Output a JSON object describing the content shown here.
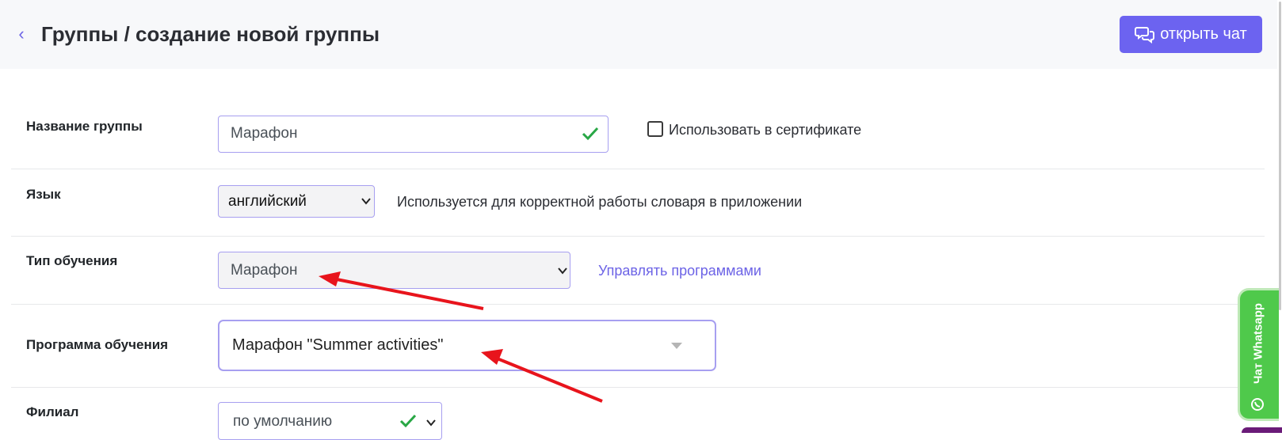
{
  "header": {
    "back_icon": "chevron-left-icon",
    "title": "Группы / создание новой группы",
    "chat_button": {
      "icon": "chat-bubbles-icon",
      "label": "открыть чат"
    }
  },
  "form": {
    "group_name": {
      "label": "Название группы",
      "value": "Марафон",
      "valid_icon": "checkmark-icon",
      "use_in_certificate": {
        "label": "Использовать в сертификате",
        "checked": false
      }
    },
    "language": {
      "label": "Язык",
      "selected": "английский",
      "hint": "Используется для корректной работы словаря в приложении"
    },
    "training_type": {
      "label": "Тип обучения",
      "selected": "Марафон",
      "manage_link": "Управлять программами"
    },
    "program": {
      "label": "Программа обучения",
      "selected": "Марафон \"Summer activities\""
    },
    "branch": {
      "label": "Филиал",
      "selected": "по умолчанию",
      "valid_icon": "checkmark-icon"
    }
  },
  "whatsapp_widget": {
    "label": "Чат Whatsapp",
    "icon": "whatsapp-icon"
  },
  "colors": {
    "accent": "#6c63f0",
    "field_border": "#a79ff0",
    "valid_check": "#28a745",
    "annotation_arrow": "#e8141c",
    "whatsapp_green": "#4fc94b"
  }
}
